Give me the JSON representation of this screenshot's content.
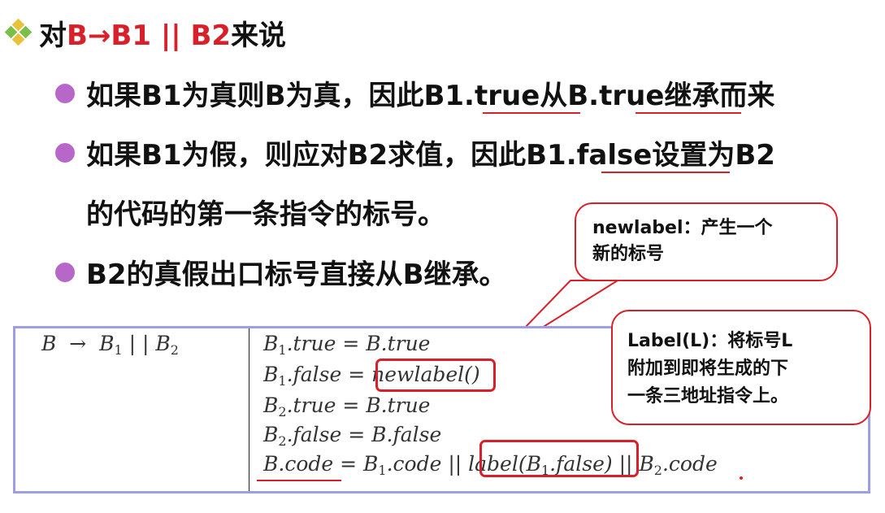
{
  "title": {
    "prefix": "对",
    "rule": "B→B1 || B2",
    "suffix": "来说"
  },
  "bullets": [
    "如果B1为真则B为真，因此B1.true从B.true继承而来",
    "如果B1为假，则应对B2求值，因此B1.false设置为B2",
    "B2的真假出口标号直接从B继承。"
  ],
  "bullet2_continued": "的代码的第一条指令的标号。",
  "production": {
    "lhs": "B",
    "arrow": "→",
    "b1": "B",
    "b1_sub": "1",
    "op": "| |",
    "b2": "B",
    "b2_sub": "2"
  },
  "rules": [
    {
      "lhs": "B",
      "sub": "1",
      "attr": ".true",
      "rhs": "= B.true"
    },
    {
      "lhs": "B",
      "sub": "1",
      "attr": ".false",
      "rhs": "= ",
      "rhs_boxed": "newlabel()"
    },
    {
      "lhs": "B",
      "sub": "2",
      "attr": ".true",
      "rhs": "= B.true"
    },
    {
      "lhs": "B",
      "sub": "2",
      "attr": ".false",
      "rhs": "= B.false"
    }
  ],
  "code_rule": {
    "lhs": "B.code",
    "eq": "= ",
    "b1": "B",
    "b1_sub": "1",
    "b1_attr": ".code",
    "sep1": " || ",
    "label_fn": "label(",
    "label_b": "B",
    "label_sub": "1",
    "label_attr": ".false)",
    "sep2": " || ",
    "b2": "B",
    "b2_sub": "2",
    "b2_attr": ".code"
  },
  "callouts": {
    "newlabel": [
      "newlabel：产生一个",
      "新的标号"
    ],
    "label": [
      "Label(L)：将标号L",
      "附加到即将生成的下",
      "一条三地址指令上。"
    ]
  },
  "colors": {
    "accent_red": "#d8202a",
    "bullet_purple": "#b767c8",
    "table_border": "#9c9ee8",
    "diamond_yellow": "#e8c23a",
    "diamond_green": "#7bbf4a"
  }
}
